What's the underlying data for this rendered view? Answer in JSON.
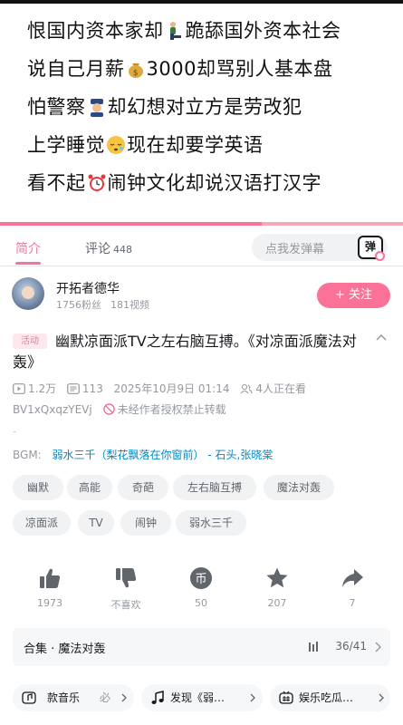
{
  "video": {
    "caption_lines": [
      {
        "before": "恨国内资本家却",
        "emoji": "kneeling-person",
        "after": "跪舔国外资本社会"
      },
      {
        "before": "说自己月薪",
        "emoji": "money-bag",
        "after": "3000却骂别人基本盘"
      },
      {
        "before": "怕警察",
        "emoji": "police-officer",
        "after": "却幻想对立方是劳改犯"
      },
      {
        "before": "上学睡觉",
        "emoji": "sleepy-face",
        "after": "现在却要学英语"
      },
      {
        "before": "看不起",
        "emoji": "alarm-clock",
        "after": "闹钟文化却说汉语打汉字"
      }
    ],
    "progress": 0.65,
    "colors": {
      "accent": "#fb7299"
    }
  },
  "tabs": {
    "intro_label": "简介",
    "comments_label": "评论",
    "comments_count": "448",
    "danmu_placeholder": "点我发弹幕",
    "danmu_button_label": "弹"
  },
  "author": {
    "name": "开拓者德华",
    "fans": "1756粉丝",
    "videos": "181视频",
    "follow_label": "+ 关注"
  },
  "video_info": {
    "activity_tag": "活动",
    "title": "幽默凉面派TV之左右脑互搏。《对凉面派魔法对轰》",
    "play_count": "1.2万",
    "danmu_count": "113",
    "date": "2025年10月9日 01:14",
    "watching": "4人正在看",
    "bvid": "BV1xQxqzYEVj",
    "copyright_notice": "未经作者授权禁止转载",
    "dash": "-",
    "bgm_label": "BGM:",
    "bgm_track": "弱水三千（梨花飘落在你窗前） - 石头,张晓棠"
  },
  "tags": [
    "幽默",
    "高能",
    "奇葩",
    "左右脑互搏",
    "魔法对轰",
    "凉面派",
    "TV",
    "闹钟",
    "弱水三千"
  ],
  "actions": {
    "like_count": "1973",
    "dislike_label": "不喜欢",
    "coin_count": "50",
    "favorite_count": "207",
    "share_count": "7"
  },
  "collection": {
    "label": "合集 · 魔法对轰",
    "progress": "36/41"
  },
  "chips": [
    {
      "icon": "music-note-box-icon",
      "label": "款音乐",
      "extra": "必"
    },
    {
      "icon": "music-note-icon",
      "label": "发现《弱…",
      "extra": ""
    },
    {
      "icon": "tv-hash-icon",
      "label": "娱乐吃瓜…",
      "extra": ""
    }
  ]
}
